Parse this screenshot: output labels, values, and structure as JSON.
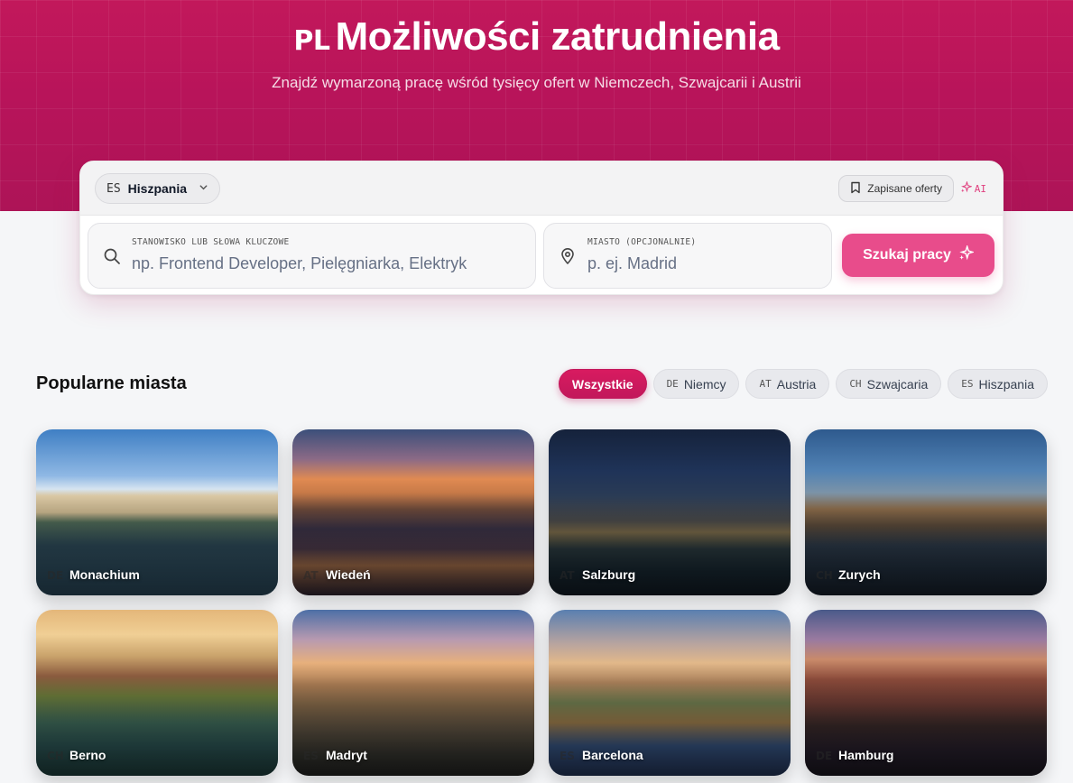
{
  "hero": {
    "country_code": "PL",
    "title": "Możliwości zatrudnienia",
    "subtitle": "Znajdź wymarzoną pracę wśród tysięcy ofert w Niemczech, Szwajcarii i Austrii"
  },
  "search": {
    "country_code": "ES",
    "country_label": "Hiszpania",
    "saved_label": "Zapisane oferty",
    "ai_label": "AI",
    "keyword_label": "STANOWISKO LUB SŁOWA KLUCZOWE",
    "keyword_placeholder": "np. Frontend Developer, Pielęgniarka, Elektryk",
    "city_label": "MIASTO (OPCJONALNIE)",
    "city_placeholder": "p. ej. Madrid",
    "submit_label": "Szukaj pracy"
  },
  "popular": {
    "title": "Popularne miasta",
    "filters": [
      {
        "code": "",
        "label": "Wszystkie",
        "active": true
      },
      {
        "code": "DE",
        "label": "Niemcy",
        "active": false
      },
      {
        "code": "AT",
        "label": "Austria",
        "active": false
      },
      {
        "code": "CH",
        "label": "Szwajcaria",
        "active": false
      },
      {
        "code": "ES",
        "label": "Hiszpania",
        "active": false
      }
    ],
    "cities": [
      {
        "code": "DE",
        "name": "Monachium"
      },
      {
        "code": "AT",
        "name": "Wiedeń"
      },
      {
        "code": "AT",
        "name": "Salzburg"
      },
      {
        "code": "CH",
        "name": "Zurych"
      },
      {
        "code": "CH",
        "name": "Berno"
      },
      {
        "code": "ES",
        "name": "Madryt"
      },
      {
        "code": "ES",
        "name": "Barcelona"
      },
      {
        "code": "DE",
        "name": "Hamburg"
      }
    ]
  },
  "icons": {
    "search": "search-icon",
    "location": "map-pin-icon",
    "bookmark": "bookmark-icon",
    "sparkle": "sparkle-icon",
    "chevron": "chevron-down-icon"
  },
  "colors": {
    "brand": "#c2185b",
    "button": "#e84c8b"
  }
}
